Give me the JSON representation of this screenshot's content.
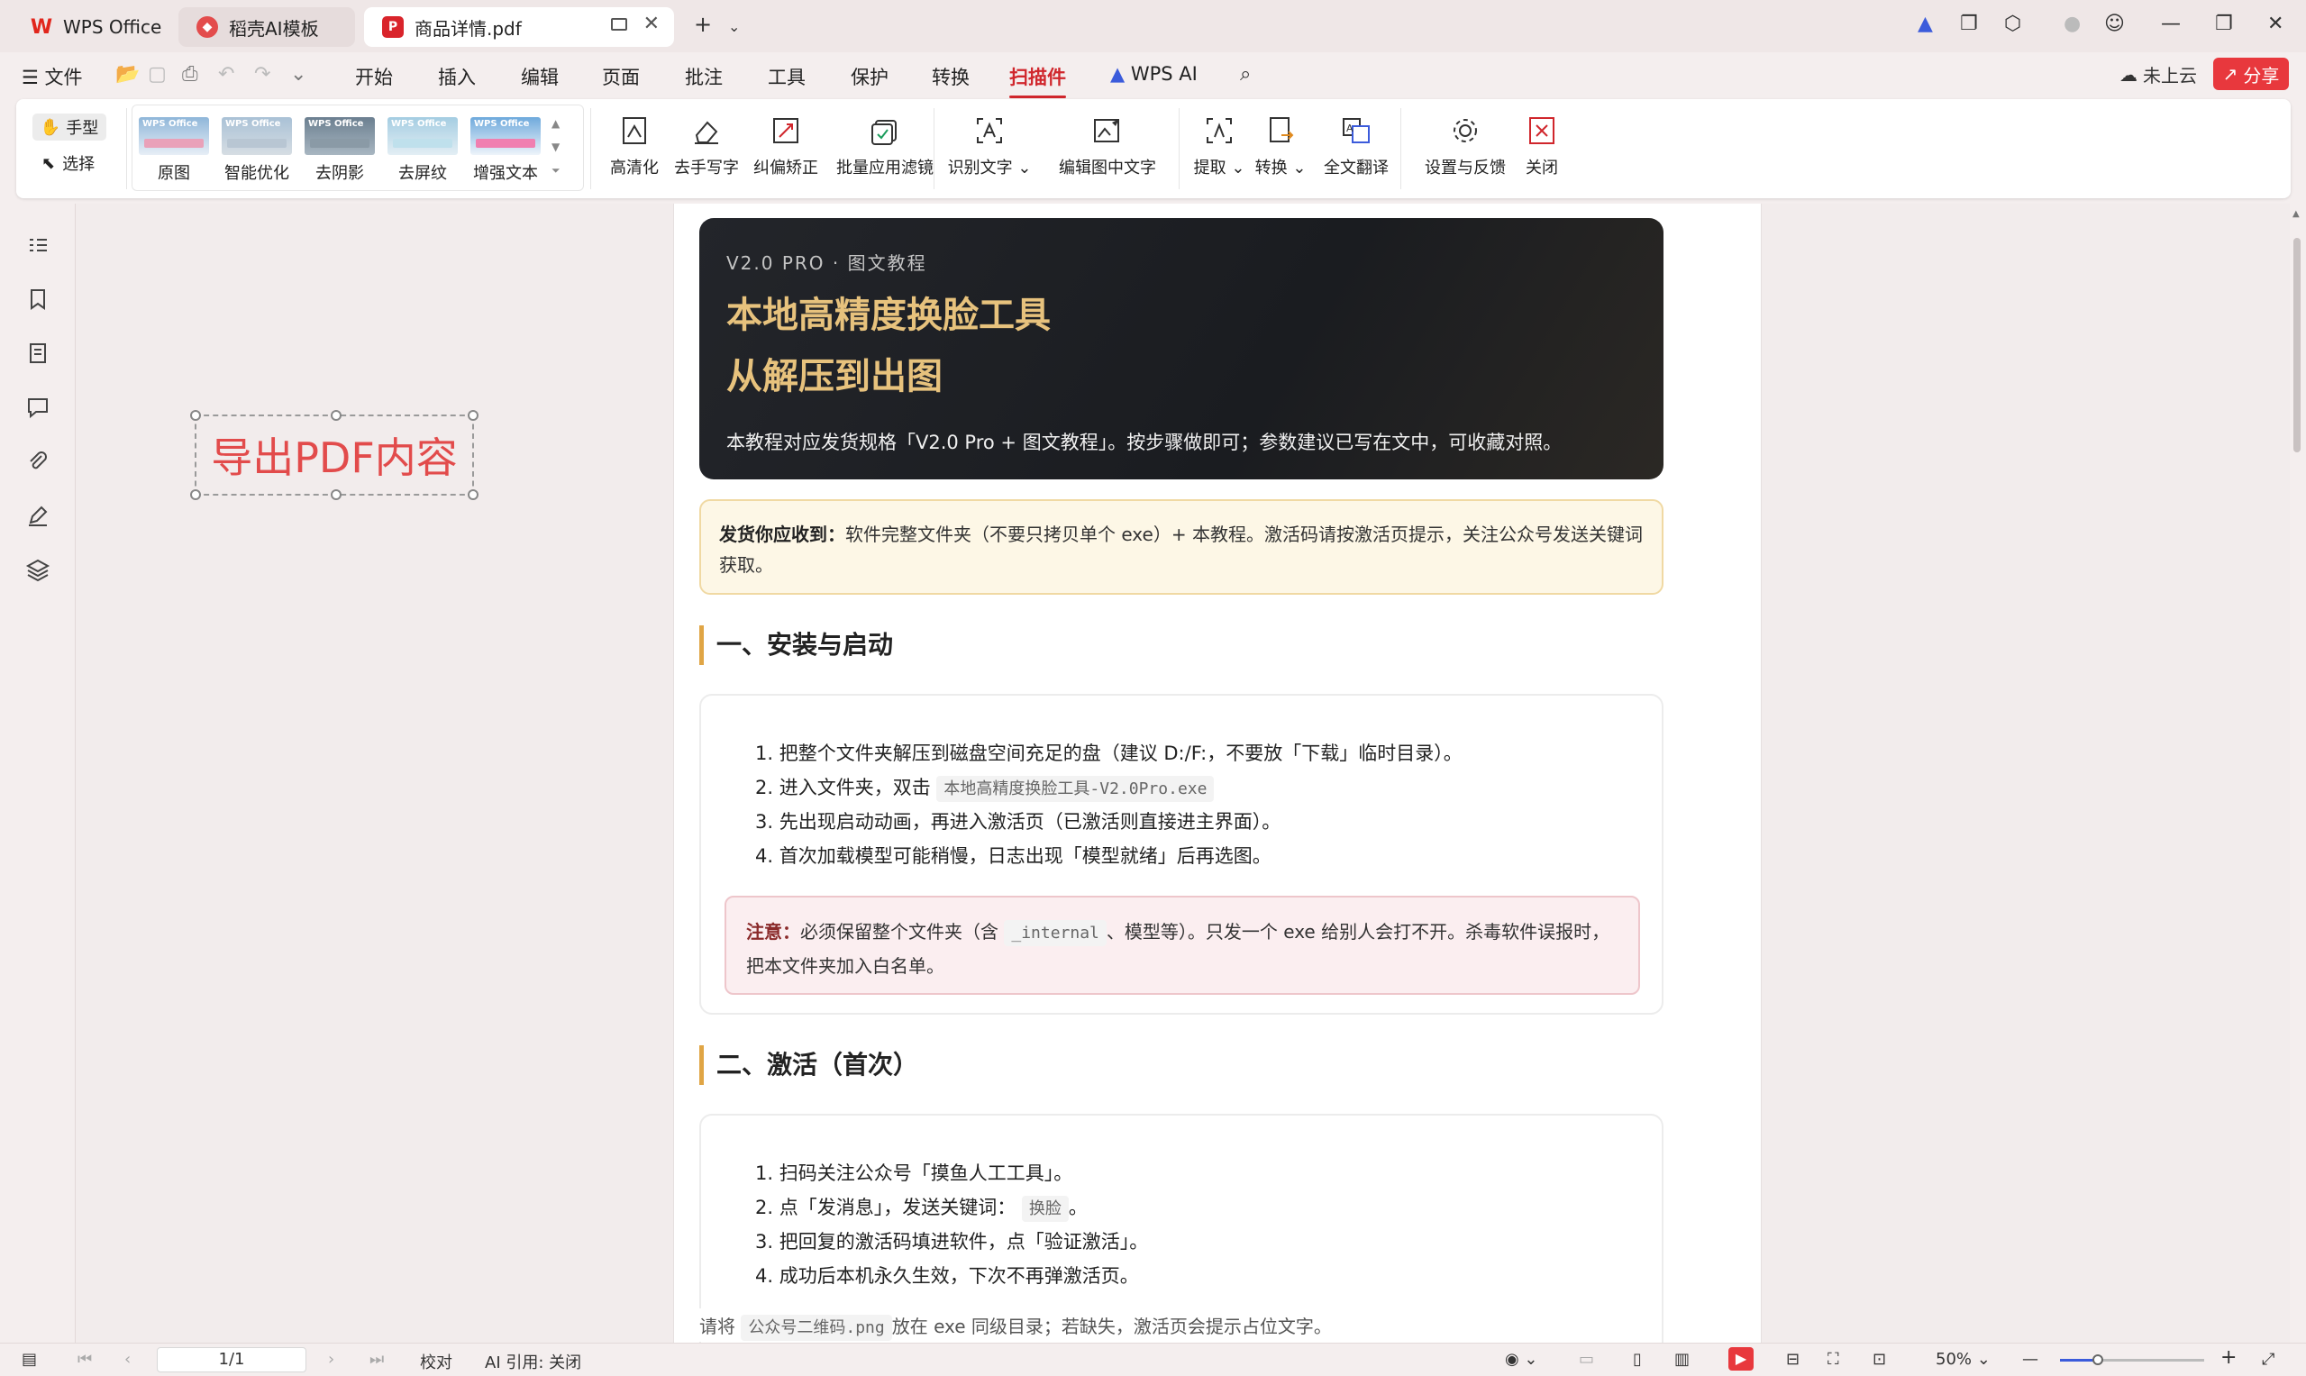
{
  "tabs": [
    {
      "label": "WPS Office"
    },
    {
      "label": "稻壳AI模板"
    },
    {
      "label": "商品详情.pdf"
    }
  ],
  "menu": {
    "file": "文件",
    "items": [
      "开始",
      "插入",
      "编辑",
      "页面",
      "批注",
      "工具",
      "保护",
      "转换",
      "扫描件"
    ],
    "active": "扫描件",
    "wps_ai": "WPS AI",
    "cloud": "未上云",
    "share": "分享"
  },
  "ribbon": {
    "hand": "手型",
    "select": "选择",
    "thumb_brand": "WPS Office",
    "filters": [
      "原图",
      "智能优化",
      "去阴影",
      "去屏纹",
      "增强文本"
    ],
    "tools1": [
      "高清化",
      "去手写字",
      "纠偏矫正",
      "批量应用滤镜"
    ],
    "tools2": [
      "识别文字",
      "编辑图中文字"
    ],
    "tools3": [
      "提取",
      "转换",
      "全文翻译"
    ],
    "tools4": [
      "设置与反馈",
      "关闭"
    ]
  },
  "annotation": {
    "text": "导出PDF内容"
  },
  "doc": {
    "kicker": "V2.0 PRO · 图文教程",
    "title1": "本地高精度换脸工具",
    "title2": "从解压到出图",
    "desc": "本教程对应发货规格「V2.0 Pro + 图文教程」。按步骤做即可；参数建议已写在文中，可收藏对照。",
    "notice_label": "发货你应收到：",
    "notice_text": "软件完整文件夹（不要只拷贝单个 exe）+ 本教程。激活码请按激活页提示，关注公众号发送关键词获取。",
    "sec1_title": "一、安装与启动",
    "sec1_steps": [
      "1. 把整个文件夹解压到磁盘空间充足的盘（建议 D:/F:，不要放「下载」临时目录）。",
      "2. 进入文件夹，双击",
      "3. 先出现启动动画，再进入激活页（已激活则直接进主界面）。",
      "4. 首次加载模型可能稍慢，日志出现「模型就绪」后再选图。"
    ],
    "sec1_code": "本地高精度换脸工具-V2.0Pro.exe",
    "warn_label": "注意：",
    "warn_pre": "必须保留整个文件夹（含",
    "warn_code": "_internal",
    "warn_post": "、模型等）。只发一个 exe 给别人会打不开。杀毒软件误报时，把本文件夹加入白名单。",
    "sec2_title": "二、激活（首次）",
    "sec2_steps": [
      "1. 扫码关注公众号「摸鱼人工工具」。",
      "2. 点「发消息」，发送关键词：",
      "3. 把回复的激活码填进软件，点「验证激活」。",
      "4. 成功后本机永久生效，下次不再弹激活页。"
    ],
    "sec2_code": "换脸",
    "tail_pre": "请将",
    "tail_code": "公众号二维码.png",
    "tail_post": "放在 exe 同级目录；若缺失，激活页会提示占位文字。"
  },
  "status": {
    "page": "1/1",
    "proof": "校对",
    "ai_ref": "AI 引用: 关闭",
    "zoom": "50%"
  },
  "colors": {
    "accent": "#d0262c",
    "hero_title": "#e7c27d",
    "heading_bar": "#e0a545"
  }
}
